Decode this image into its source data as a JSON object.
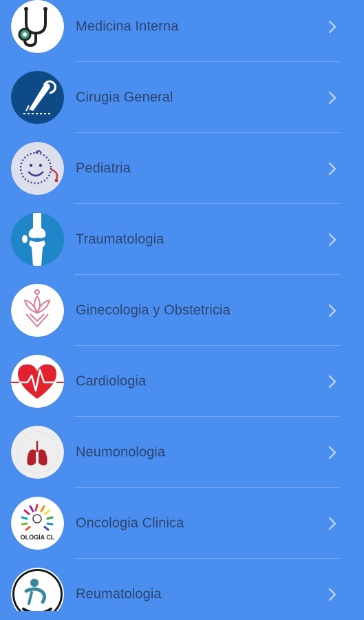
{
  "colors": {
    "background": "#4a8ff0",
    "label": "#2e4470",
    "chevron": "#c8d8f2"
  },
  "specialties": [
    {
      "label": "Medicina Interna",
      "icon": "stethoscope-icon"
    },
    {
      "label": "Cirugia General",
      "icon": "scalpel-hand-icon"
    },
    {
      "label": "Pediatria",
      "icon": "baby-face-icon"
    },
    {
      "label": "Traumatologia",
      "icon": "knee-bone-icon"
    },
    {
      "label": "Ginecologia y Obstetricia",
      "icon": "lotus-icon"
    },
    {
      "label": "Cardiologia",
      "icon": "heart-pulse-icon"
    },
    {
      "label": "Neumonologia",
      "icon": "lungs-icon"
    },
    {
      "label": "Oncologia Clinica",
      "icon": "ribbon-circle-icon",
      "badge_text": "OLOGÍA CL"
    },
    {
      "label": "Reumatologia",
      "icon": "rheumatology-figure-icon"
    }
  ]
}
